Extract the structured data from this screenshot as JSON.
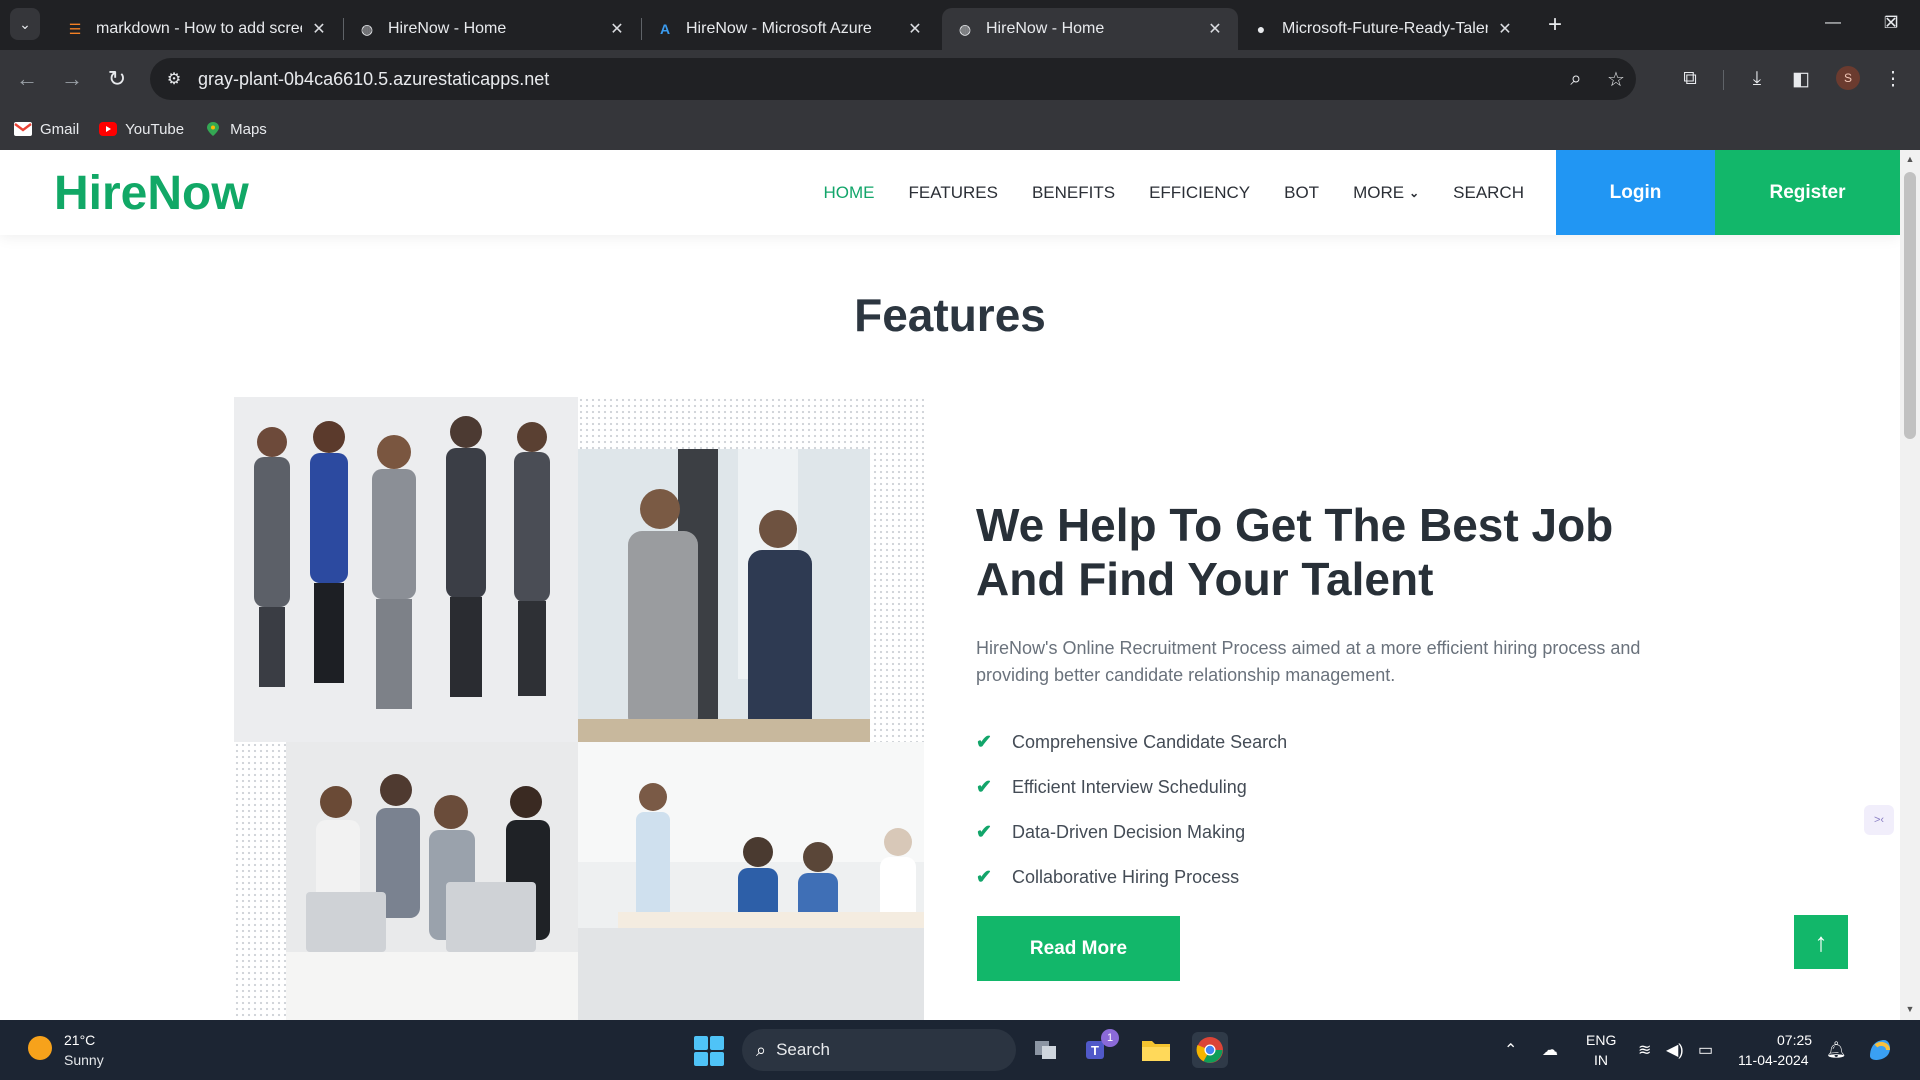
{
  "browser": {
    "tabs": [
      {
        "title": "markdown - How to add screen",
        "active": false
      },
      {
        "title": "HireNow - Home",
        "active": false
      },
      {
        "title": "HireNow - Microsoft Azure",
        "active": false
      },
      {
        "title": "HireNow - Home",
        "active": true
      },
      {
        "title": "Microsoft-Future-Ready-Talent-",
        "active": false
      }
    ],
    "url": "gray-plant-0b4ca6610.5.azurestaticapps.net",
    "profile_initial": "S",
    "bookmarks": [
      {
        "label": "Gmail",
        "icon": "gmail-icon",
        "color": "#ea4335"
      },
      {
        "label": "YouTube",
        "icon": "youtube-icon",
        "color": "#ff0000"
      },
      {
        "label": "Maps",
        "icon": "maps-icon",
        "color": "#34a853"
      }
    ]
  },
  "site": {
    "logo": "HireNow",
    "nav": [
      "HOME",
      "FEATURES",
      "BENEFITS",
      "EFFICIENCY",
      "BOT",
      "MORE",
      "SEARCH"
    ],
    "active_nav": "HOME",
    "login_label": "Login",
    "register_label": "Register"
  },
  "features": {
    "section_title": "Features",
    "headline": "We Help To Get The Best Job And Find Your Talent",
    "intro": "HireNow's Online Recruitment Process aimed at a more efficient hiring process and providing better candidate relationship management.",
    "items": [
      "Comprehensive Candidate Search",
      "Efficient Interview Scheduling",
      "Data-Driven Decision Making",
      "Collaborative Hiring Process"
    ],
    "read_more_label": "Read More"
  },
  "taskbar": {
    "temperature": "21°C",
    "condition": "Sunny",
    "search_label": "Search",
    "teams_badge": "1",
    "lang_line1": "ENG",
    "lang_line2": "IN",
    "time": "07:25",
    "date": "11-04-2024"
  },
  "colors": {
    "brand_green": "#12b76a",
    "login_blue": "#2196f3",
    "heading_dark": "#283038"
  }
}
